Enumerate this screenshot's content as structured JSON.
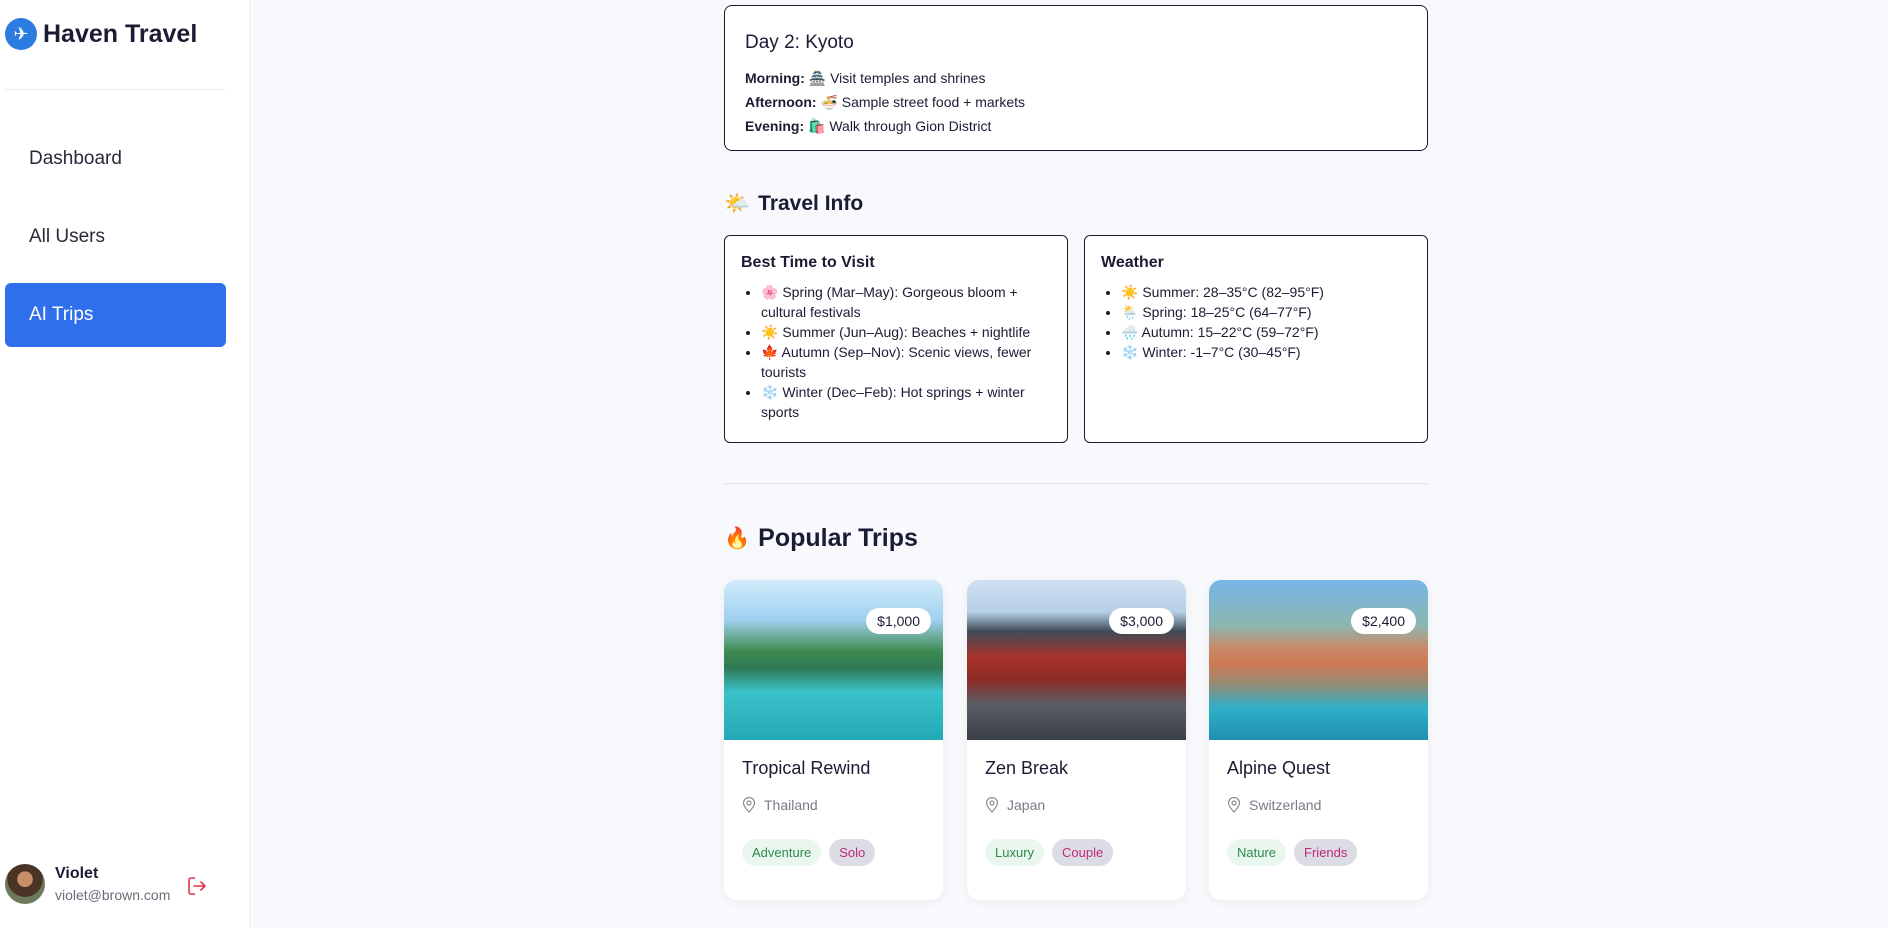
{
  "app": {
    "name": "Haven Travel",
    "logo_icon": "airplane-globe-icon",
    "accent": "#2f6fec"
  },
  "sidebar": {
    "items": [
      {
        "label": "Dashboard",
        "active": false
      },
      {
        "label": "All Users",
        "active": false
      },
      {
        "label": "AI Trips",
        "active": true
      }
    ]
  },
  "user": {
    "name": "Violet",
    "email": "violet@brown.com",
    "logout_icon": "logout-icon"
  },
  "itinerary": {
    "day_title": "Day 2: Kyoto",
    "morning": {
      "label": "Morning:",
      "text": "🏯 Visit temples and shrines"
    },
    "afternoon": {
      "label": "Afternoon:",
      "text": "🍜 Sample street food + markets"
    },
    "evening": {
      "label": "Evening:",
      "text": "🛍️ Walk through Gion District"
    }
  },
  "travel_info": {
    "title": "Travel Info",
    "icon": "🌤️",
    "best_time": {
      "heading": "Best Time to Visit",
      "items": [
        "🌸 Spring (Mar–May): Gorgeous bloom + cultural festivals",
        "☀️ Summer (Jun–Aug): Beaches + nightlife",
        "🍁 Autumn (Sep–Nov): Scenic views, fewer tourists",
        "❄️ Winter (Dec–Feb): Hot springs + winter sports"
      ]
    },
    "weather": {
      "heading": "Weather",
      "items": [
        "☀️ Summer: 28–35°C (82–95°F)",
        "🌦️ Spring: 18–25°C (64–77°F)",
        "🌧️ Autumn: 15–22°C (59–72°F)",
        "❄️ Winter: -1–7°C (30–45°F)"
      ]
    }
  },
  "popular": {
    "title": "Popular Trips",
    "icon": "🔥",
    "trips": [
      {
        "name": "Tropical Rewind",
        "location": "Thailand",
        "price": "$1,000",
        "tags": [
          "Adventure",
          "Solo"
        ]
      },
      {
        "name": "Zen Break",
        "location": "Japan",
        "price": "$3,000",
        "tags": [
          "Luxury",
          "Couple"
        ]
      },
      {
        "name": "Alpine Quest",
        "location": "Switzerland",
        "price": "$2,400",
        "tags": [
          "Nature",
          "Friends"
        ]
      }
    ]
  }
}
